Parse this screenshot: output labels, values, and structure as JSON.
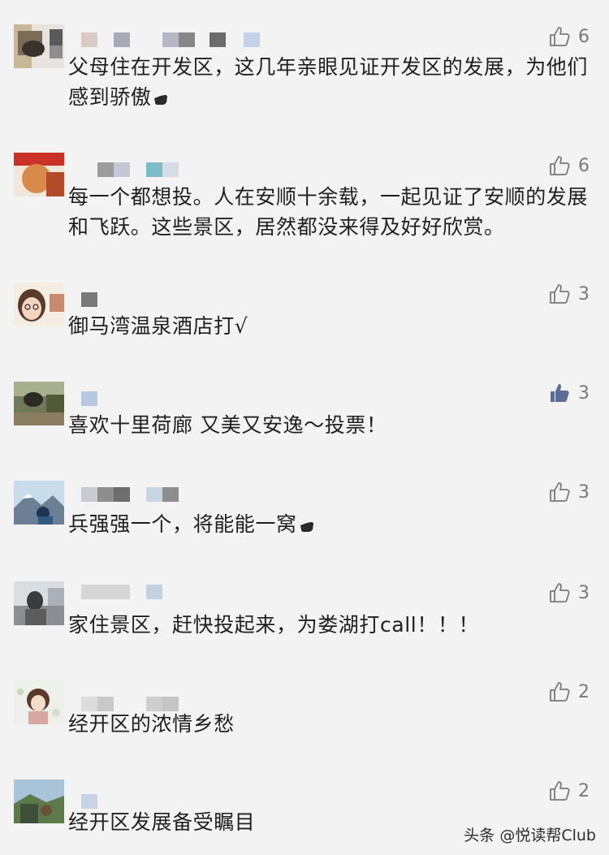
{
  "comments": [
    {
      "text": "父母住在开发区，这几年亲眼见证开发区的发展，为他们感到骄傲",
      "likes": "6",
      "liked": false
    },
    {
      "text": "每一个都想投。人在安顺十余载，一起见证了安顺的发展和飞跃。这些景区，居然都没来得及好好欣赏。",
      "likes": "6",
      "liked": false
    },
    {
      "text": "御马湾温泉酒店打√",
      "likes": "3",
      "liked": false
    },
    {
      "text": "喜欢十里荷廊 又美又安逸～投票！",
      "likes": "3",
      "liked": true
    },
    {
      "text": "兵强强一个，将能能一窝",
      "likes": "3",
      "liked": false
    },
    {
      "text": "家住景区，赶快投起来，为娄湖打call！！！",
      "likes": "3",
      "liked": false
    },
    {
      "text": "经开区的浓情乡愁",
      "likes": "2",
      "liked": false
    },
    {
      "text": "经开区发展备受瞩目",
      "likes": "2",
      "liked": false
    }
  ],
  "watermark": "头条 @悦读帮Club",
  "icons": {
    "like": "thumbs-up-icon",
    "hand": "pointing-hand-icon"
  },
  "colors": {
    "background": "#f3f3f3",
    "text": "#1f1f1f",
    "like_count": "#7a7a7a",
    "liked_icon": "#5a6e94"
  }
}
